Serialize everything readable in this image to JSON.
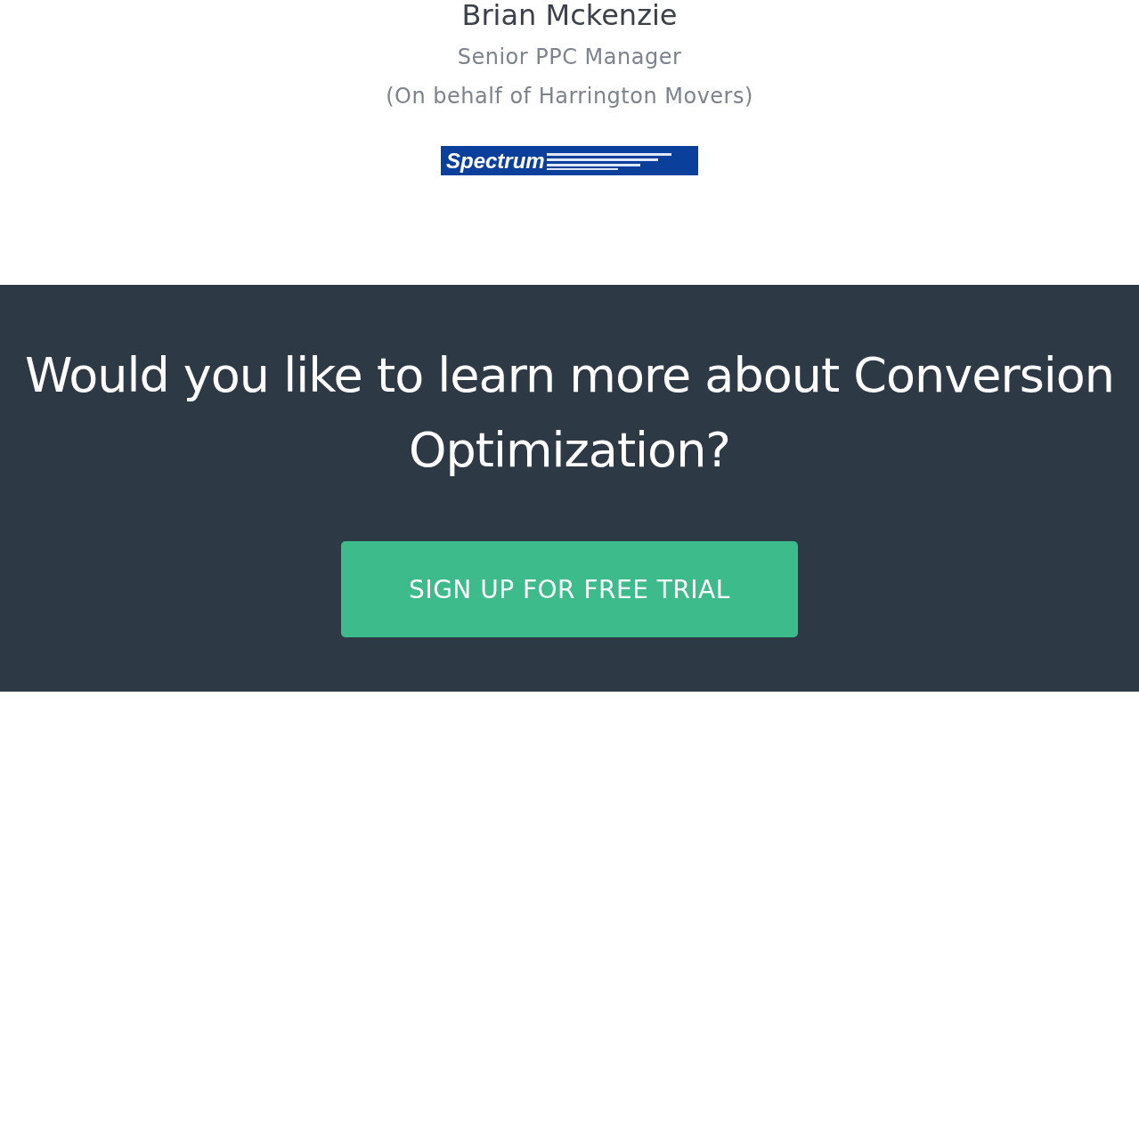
{
  "testimonial": {
    "name": "Brian Mckenzie",
    "role": "Senior PPC Manager",
    "affiliation": "(On behalf of Harrington Movers)",
    "logo_text": "Spectrum"
  },
  "cta": {
    "heading": "Would you like to learn more about Conversion Optimization?",
    "button": "SIGN UP FOR FREE TRIAL"
  }
}
